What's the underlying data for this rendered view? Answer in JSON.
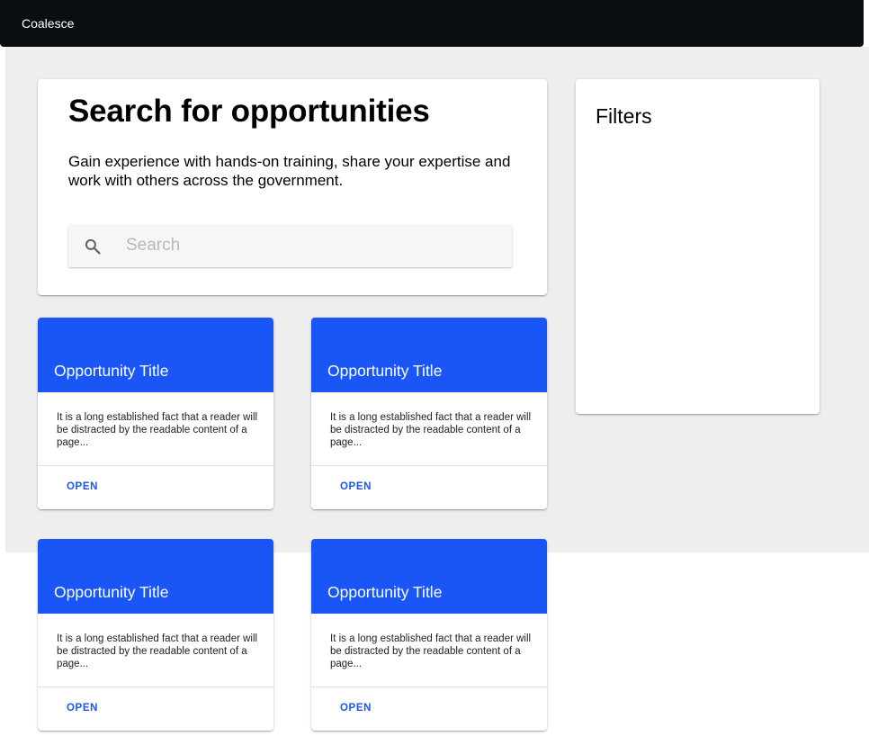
{
  "header": {
    "app_title": "Coalesce"
  },
  "hero": {
    "title": "Search for opportunities",
    "subtitle": "Gain experience with hands-on training, share your expertise and work with others across the government.",
    "search": {
      "placeholder": "Search",
      "value": "",
      "icon": "search-icon"
    }
  },
  "filters": {
    "title": "Filters"
  },
  "opportunities": [
    {
      "title": "Opportunity Title",
      "description": "It is a long established fact that a reader will be distracted by the readable content of a page...",
      "action": "OPEN"
    },
    {
      "title": "Opportunity Title",
      "description": "It is a long established fact that a reader will be distracted by the readable content of a page...",
      "action": "OPEN"
    },
    {
      "title": "Opportunity Title",
      "description": "It is a long established fact that a reader will be distracted by the readable content of a page...",
      "action": "OPEN"
    },
    {
      "title": "Opportunity Title",
      "description": "It is a long established fact that a reader will be distracted by the readable content of a page...",
      "action": "OPEN"
    }
  ],
  "colors": {
    "topbar": "#0b0e10",
    "accent": "#1a56f5",
    "background": "#eeeeee"
  }
}
